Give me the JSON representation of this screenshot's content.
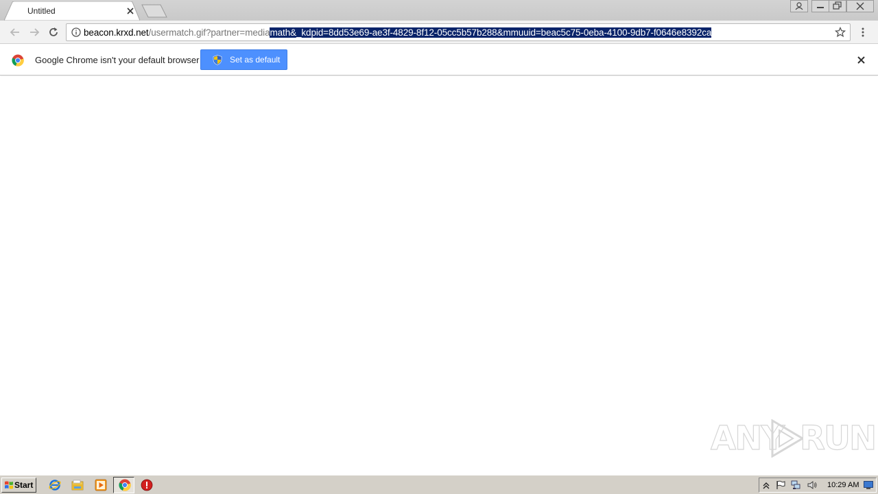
{
  "window": {
    "tab_title": "Untitled"
  },
  "address_bar": {
    "host": "beacon.krxd.net",
    "path_unselected": "/usermatch.gif?partner=media",
    "path_selected": "math&_kdpid=8dd53e69-ae3f-4829-8f12-05cc5b57b288&mmuuid=beac5c75-0eba-4100-9db7-f0646e8392ca"
  },
  "infobar": {
    "message": "Google Chrome isn't your default browser",
    "button_label": "Set as default"
  },
  "watermark": {
    "left": "ANY",
    "right": "RUN"
  },
  "taskbar": {
    "start_label": "Start",
    "clock": "10:29 AM"
  },
  "colors": {
    "selection": "#0a246a",
    "button_blue": "#4d90fe",
    "taskbar": "#d4d0c8"
  }
}
